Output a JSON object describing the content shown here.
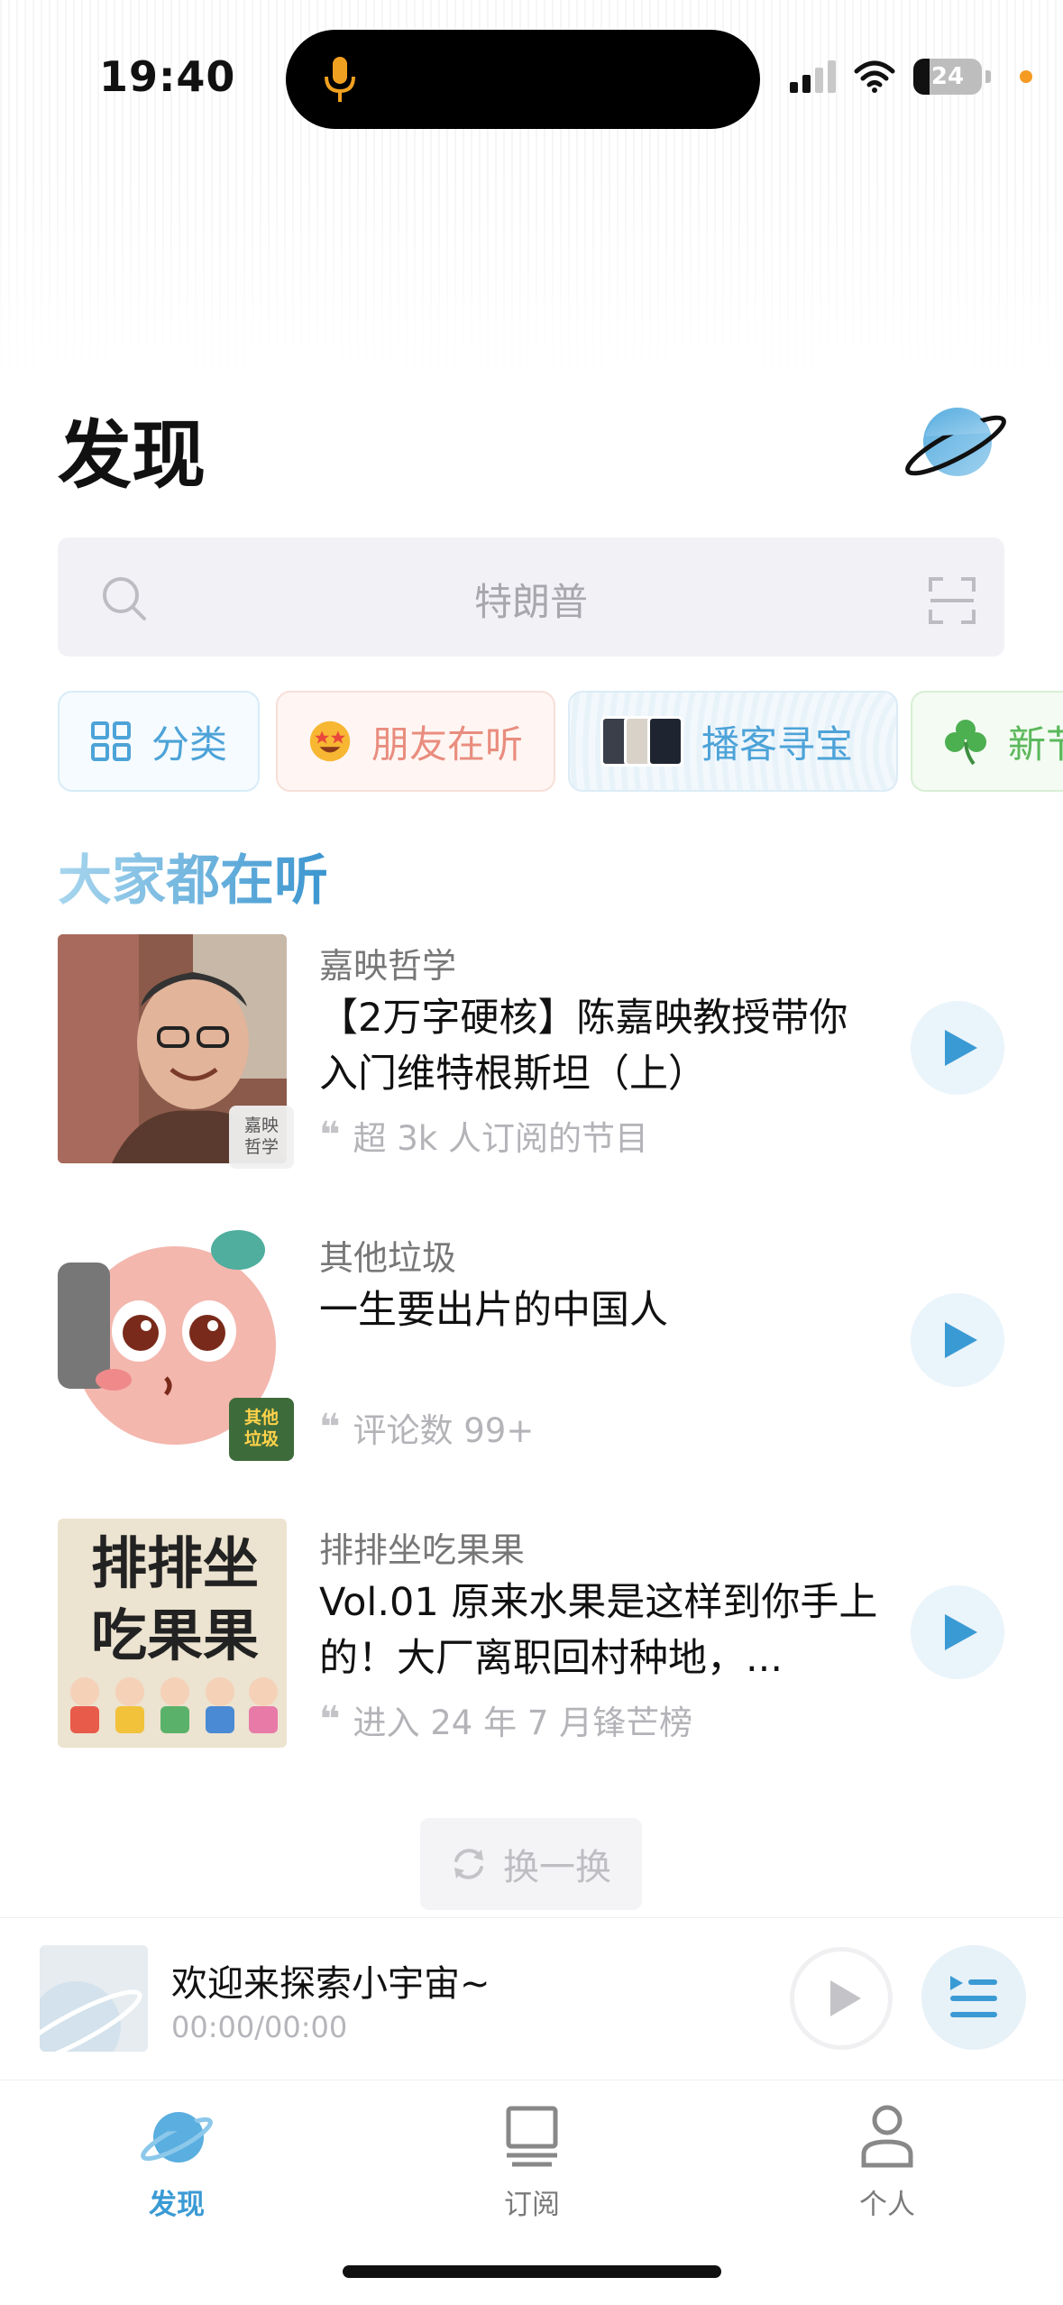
{
  "status_bar": {
    "time": "19:40",
    "battery": "24"
  },
  "header": {
    "title": "发现"
  },
  "search": {
    "placeholder": "特朗普"
  },
  "chips": [
    {
      "label": "分类",
      "icon": "grid-icon"
    },
    {
      "label": "朋友在听",
      "icon": "star-eyes-emoji-icon"
    },
    {
      "label": "播客寻宝",
      "icon": "avatar-stack-icon"
    },
    {
      "label": "新节",
      "icon": "clover-icon"
    }
  ],
  "section": {
    "title": "大家都在听"
  },
  "items": [
    {
      "author": "嘉映哲学",
      "title": "【2万字硬核】陈嘉映教授带你入门维特根斯坦（上）",
      "meta": "超 3k 人订阅的节目",
      "badge": "嘉映哲学"
    },
    {
      "author": "其他垃圾",
      "title": "一生要出片的中国人",
      "meta": "评论数 99+",
      "badge": "其他垃圾"
    },
    {
      "author": "排排坐吃果果",
      "title": "Vol.01 原来水果是这样到你手上的！大厂离职回村种地，...",
      "meta": "进入 24 年 7 月锋芒榜",
      "cover_text": "排排坐吃果果"
    }
  ],
  "refresh": {
    "label": "换一换"
  },
  "player": {
    "title": "欢迎来探索小宇宙~",
    "time": "00:00/00:00"
  },
  "tabs": [
    {
      "label": "发现",
      "active": true
    },
    {
      "label": "订阅",
      "active": false
    },
    {
      "label": "个人",
      "active": false
    }
  ],
  "colors": {
    "accent": "#3a9ad4",
    "friend": "#e98d7e",
    "green": "#5cb85c"
  }
}
